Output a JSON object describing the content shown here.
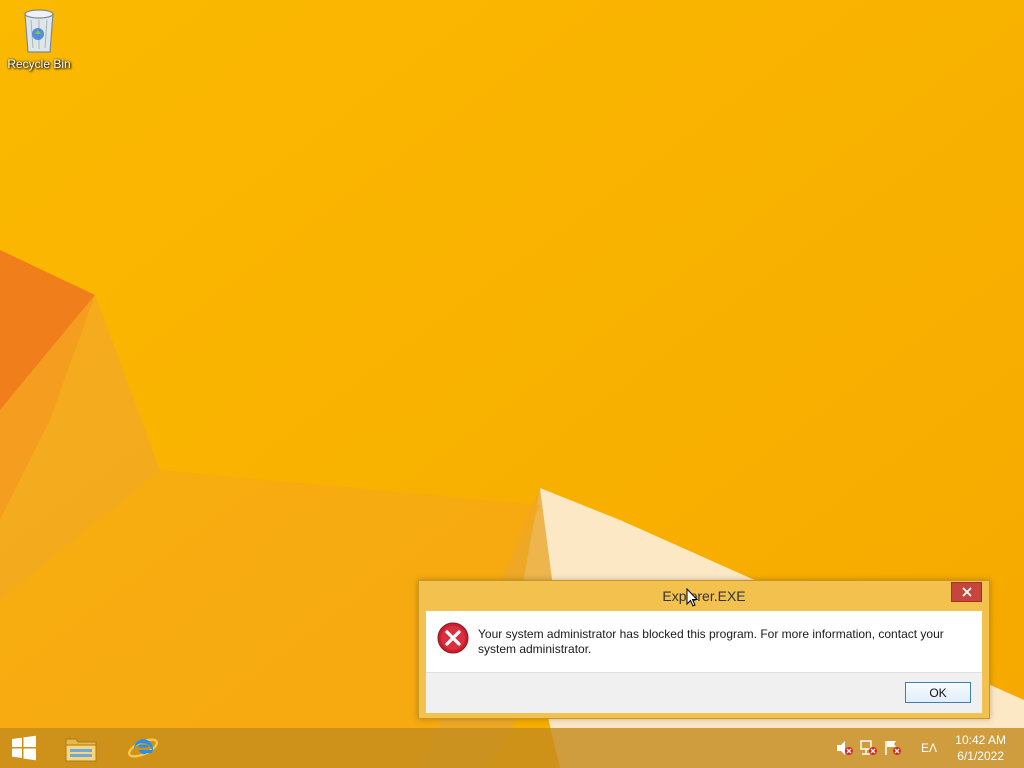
{
  "desktop": {
    "icons": [
      {
        "label": "Recycle Bin",
        "icon": "recycle-bin-icon"
      }
    ]
  },
  "dialog": {
    "title": "Explorer.EXE",
    "message_line1": "Your system administrator has blocked this program. For more information, contact your",
    "message_line2": "system administrator.",
    "ok_label": "OK",
    "icon": "error-icon",
    "close_icon": "close-icon"
  },
  "taskbar": {
    "pinned": [
      {
        "name": "File Explorer",
        "icon": "file-explorer-icon"
      },
      {
        "name": "Internet Explorer",
        "icon": "internet-explorer-icon"
      }
    ],
    "tray": {
      "icons": [
        "volume-muted-icon",
        "network-icon",
        "action-center-flag-icon"
      ],
      "language": "ΕΛ",
      "time": "10:42 AM",
      "date": "6/1/2022"
    }
  },
  "colors": {
    "wallpaper_base": "#f9b200",
    "dialog_frame": "#f2c14e",
    "close_button": "#c7463b",
    "taskbar": "#c48c1e"
  }
}
